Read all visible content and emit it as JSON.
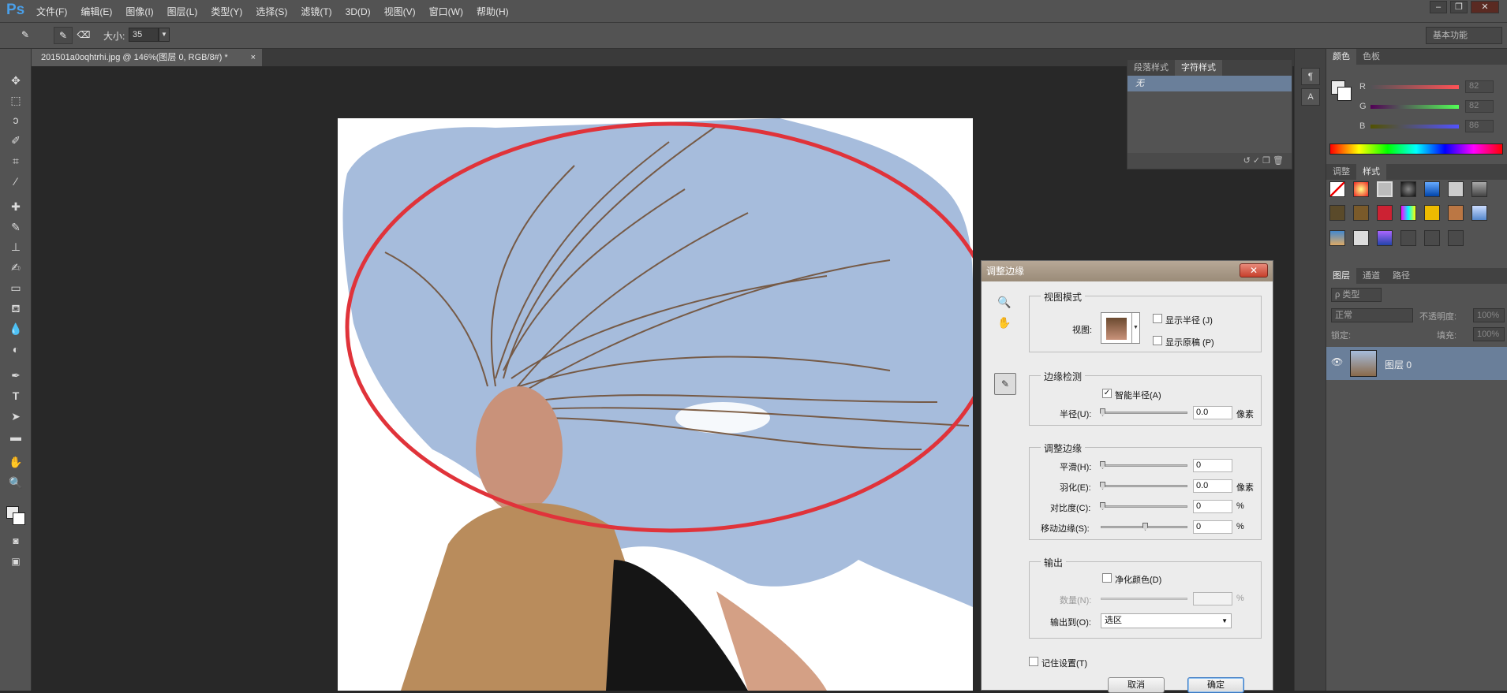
{
  "app": {
    "logo": "Ps"
  },
  "menu": [
    "文件(F)",
    "编辑(E)",
    "图像(I)",
    "图层(L)",
    "类型(Y)",
    "选择(S)",
    "滤镜(T)",
    "3D(D)",
    "视图(V)",
    "窗口(W)",
    "帮助(H)"
  ],
  "options": {
    "size_label": "大小:",
    "size_value": "35",
    "workspace": "基本功能"
  },
  "document": {
    "tab_title": "201501a0oqhtrhi.jpg @ 146%(图层 0, RGB/8#) *",
    "close": "×"
  },
  "char_panel": {
    "tabs": [
      "段落样式",
      "字符样式"
    ],
    "active_tab": "字符样式",
    "item": "无"
  },
  "color_panel": {
    "tabs": [
      "颜色",
      "色板"
    ],
    "channels": [
      {
        "name": "R",
        "value": "82"
      },
      {
        "name": "G",
        "value": "82"
      },
      {
        "name": "B",
        "value": "86"
      }
    ]
  },
  "styles_panel": {
    "tabs": [
      "调整",
      "样式"
    ]
  },
  "layers_panel": {
    "tabs": [
      "图层",
      "通道",
      "路径"
    ],
    "filter": "ρ 类型",
    "blend_mode": "正常",
    "opacity_label": "不透明度:",
    "opacity": "100%",
    "lock_label": "锁定:",
    "fill_label": "填充:",
    "fill": "100%",
    "layer_name": "图层 0"
  },
  "dialog": {
    "title": "调整边缘",
    "close": "✕",
    "view_mode": {
      "title": "视图模式",
      "view_label": "视图:",
      "show_radius": "显示半径 (J)",
      "show_original": "显示原稿 (P)"
    },
    "edge_detection": {
      "title": "边缘检测",
      "smart_radius": "智能半径(A)",
      "radius_label": "半径(U):",
      "radius_value": "0.0",
      "radius_unit": "像素"
    },
    "adjust_edge": {
      "title": "调整边缘",
      "smooth_label": "平滑(H):",
      "smooth_value": "0",
      "feather_label": "羽化(E):",
      "feather_value": "0.0",
      "feather_unit": "像素",
      "contrast_label": "对比度(C):",
      "contrast_value": "0",
      "contrast_unit": "%",
      "shift_label": "移动边缘(S):",
      "shift_value": "0",
      "shift_unit": "%"
    },
    "output": {
      "title": "输出",
      "decontaminate": "净化颜色(D)",
      "amount_label": "数量(N):",
      "amount_unit": "%",
      "output_to_label": "输出到(O):",
      "output_to_value": "选区"
    },
    "remember": "记住设置(T)",
    "cancel": "取消",
    "ok": "确定"
  }
}
